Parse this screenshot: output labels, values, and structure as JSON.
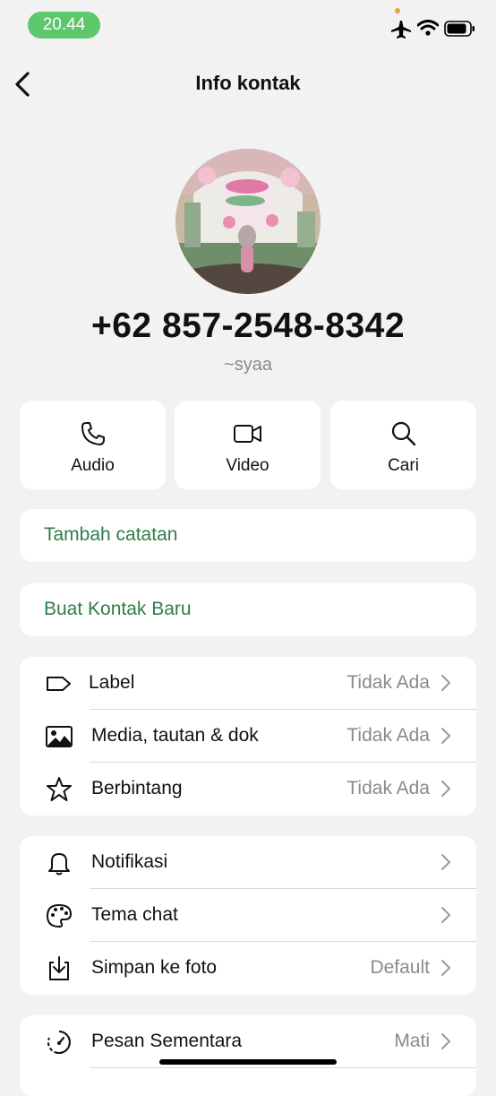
{
  "status": {
    "time": "20.44"
  },
  "nav": {
    "title": "Info kontak"
  },
  "contact": {
    "phone": "+62 857-2548-8342",
    "name": "~syaa"
  },
  "actions": [
    {
      "label": "Audio",
      "icon": "phone-icon"
    },
    {
      "label": "Video",
      "icon": "video-icon"
    },
    {
      "label": "Cari",
      "icon": "search-icon"
    }
  ],
  "add_note": "Tambah catatan",
  "new_contact": "Buat Kontak Baru",
  "group1": [
    {
      "label": "Label",
      "value": "Tidak Ada",
      "icon": "tag-icon"
    },
    {
      "label": "Media, tautan & dok",
      "value": "Tidak Ada",
      "icon": "image-icon"
    },
    {
      "label": "Berbintang",
      "value": "Tidak Ada",
      "icon": "star-icon"
    }
  ],
  "group2": [
    {
      "label": "Notifikasi",
      "value": "",
      "icon": "bell-icon"
    },
    {
      "label": "Tema chat",
      "value": "",
      "icon": "palette-icon"
    },
    {
      "label": "Simpan ke foto",
      "value": "Default",
      "icon": "download-icon"
    }
  ],
  "group3": [
    {
      "label": "Pesan Sementara",
      "value": "Mati",
      "icon": "timer-icon"
    }
  ],
  "colors": {
    "accent_green": "#2f7d48",
    "status_green": "#5cc76b"
  }
}
